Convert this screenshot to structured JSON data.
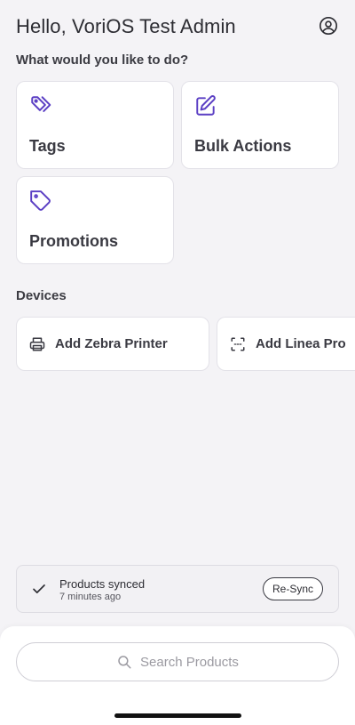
{
  "header": {
    "greeting": "Hello, VoriOS Test Admin",
    "profile_icon": "user-circle-icon"
  },
  "actions": {
    "title": "What would you like to do?",
    "items": [
      {
        "label": "Tags",
        "icon": "tags-icon"
      },
      {
        "label": "Bulk Actions",
        "icon": "edit-icon"
      },
      {
        "label": "Promotions",
        "icon": "tag-icon"
      }
    ]
  },
  "devices": {
    "title": "Devices",
    "items": [
      {
        "label": "Add Zebra Printer",
        "icon": "printer-icon"
      },
      {
        "label": "Add Linea Pro",
        "icon": "scan-icon"
      }
    ]
  },
  "sync": {
    "status": "Products synced",
    "time": "7 minutes ago",
    "button_label": "Re-Sync",
    "icon": "check-icon"
  },
  "search": {
    "placeholder": "Search Products",
    "icon": "search-icon"
  },
  "colors": {
    "accent": "#5b3fc4",
    "background": "#f4f3f6",
    "card": "#ffffff"
  }
}
